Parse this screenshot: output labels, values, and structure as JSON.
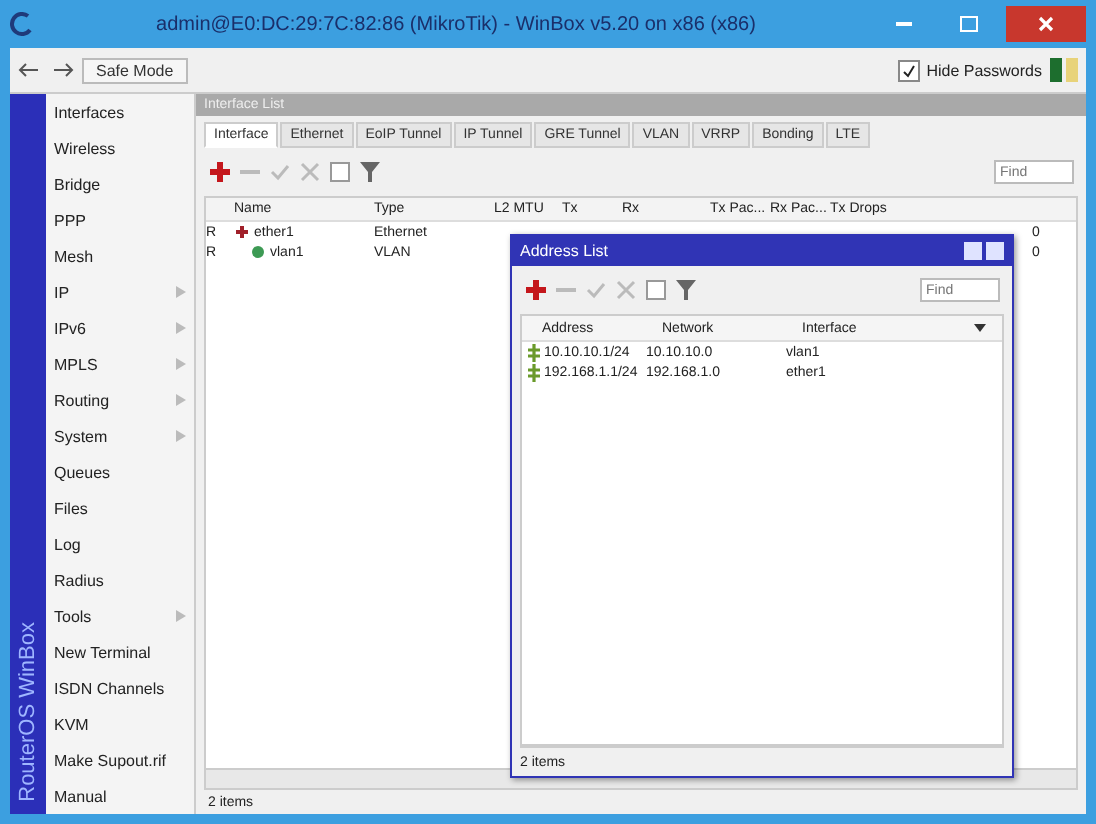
{
  "window": {
    "title": "admin@E0:DC:29:7C:82:86 (MikroTik) - WinBox v5.20 on x86 (x86)"
  },
  "toolbar": {
    "safe_mode": "Safe Mode",
    "hide_passwords": {
      "label": "Hide Passwords",
      "checked": true
    }
  },
  "sidebar": {
    "brand": "RouterOS WinBox",
    "items": [
      {
        "label": "Interfaces",
        "submenu": false
      },
      {
        "label": "Wireless",
        "submenu": false
      },
      {
        "label": "Bridge",
        "submenu": false
      },
      {
        "label": "PPP",
        "submenu": false
      },
      {
        "label": "Mesh",
        "submenu": false
      },
      {
        "label": "IP",
        "submenu": true
      },
      {
        "label": "IPv6",
        "submenu": true
      },
      {
        "label": "MPLS",
        "submenu": true
      },
      {
        "label": "Routing",
        "submenu": true
      },
      {
        "label": "System",
        "submenu": true
      },
      {
        "label": "Queues",
        "submenu": false
      },
      {
        "label": "Files",
        "submenu": false
      },
      {
        "label": "Log",
        "submenu": false
      },
      {
        "label": "Radius",
        "submenu": false
      },
      {
        "label": "Tools",
        "submenu": true
      },
      {
        "label": "New Terminal",
        "submenu": false
      },
      {
        "label": "ISDN Channels",
        "submenu": false
      },
      {
        "label": "KVM",
        "submenu": false
      },
      {
        "label": "Make Supout.rif",
        "submenu": false
      },
      {
        "label": "Manual",
        "submenu": false
      }
    ]
  },
  "interface_list": {
    "title": "Interface List",
    "tabs": [
      {
        "label": "Interface",
        "selected": true
      },
      {
        "label": "Ethernet",
        "selected": false
      },
      {
        "label": "EoIP Tunnel",
        "selected": false
      },
      {
        "label": "IP Tunnel",
        "selected": false
      },
      {
        "label": "GRE Tunnel",
        "selected": false
      },
      {
        "label": "VLAN",
        "selected": false
      },
      {
        "label": "VRRP",
        "selected": false
      },
      {
        "label": "Bonding",
        "selected": false
      },
      {
        "label": "LTE",
        "selected": false
      }
    ],
    "find": {
      "placeholder": "Find"
    },
    "columns": [
      "Name",
      "Type",
      "L2 MTU",
      "Tx",
      "Rx",
      "Tx Pac...",
      "Rx Pac...",
      "Tx Drops"
    ],
    "rows": [
      {
        "flag": "R",
        "name": "ether1",
        "type": "Ethernet",
        "tx_drops": "0",
        "kind": "ethernet"
      },
      {
        "flag": "R",
        "name": "vlan1",
        "type": "VLAN",
        "tx_drops": "0",
        "kind": "vlan"
      }
    ],
    "status": "2 items"
  },
  "address_list": {
    "title": "Address List",
    "find": {
      "placeholder": "Find"
    },
    "columns": [
      "Address",
      "Network",
      "Interface"
    ],
    "rows": [
      {
        "address": "10.10.10.1/24",
        "network": "10.10.10.0",
        "interface": "vlan1"
      },
      {
        "address": "192.168.1.1/24",
        "network": "192.168.1.0",
        "interface": "ether1"
      }
    ],
    "status": "2 items"
  }
}
